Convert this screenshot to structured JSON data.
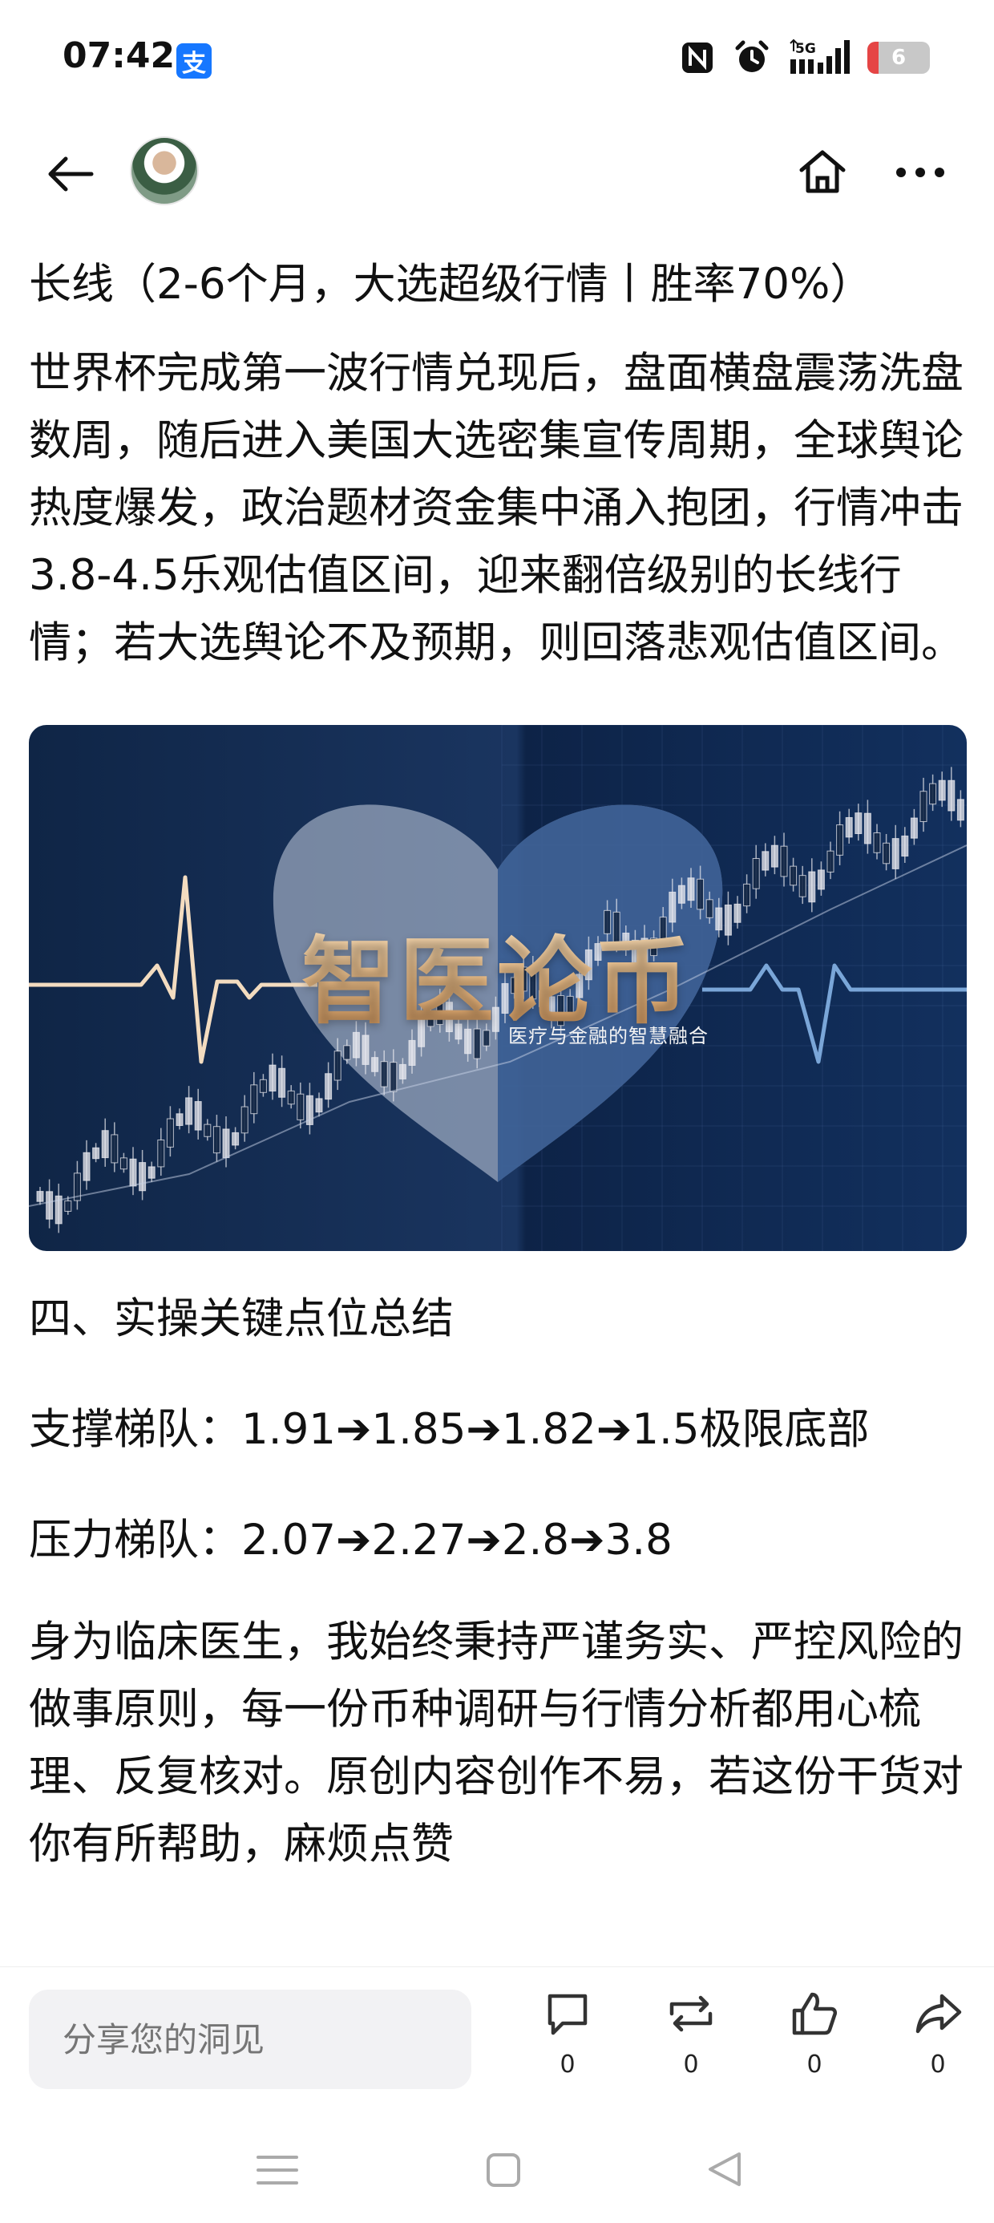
{
  "status_bar": {
    "time": "07:42",
    "alipay_glyph": "支",
    "network": "5G",
    "battery_level": "6",
    "battery_fraction": 0.06,
    "icons": [
      "alipay-icon",
      "nfc-icon",
      "alarm-icon",
      "signal-5g-icon",
      "battery-icon"
    ]
  },
  "header": {
    "icons": [
      "back-arrow-icon",
      "avatar",
      "home-icon",
      "more-icon"
    ]
  },
  "article": {
    "headline": "长线（2-6个月，大选超级行情丨胜率70%）",
    "paragraph1": "世界杯完成第一波行情兑现后，盘面横盘震荡洗盘数周，随后进入美国大选密集宣传周期，全球舆论热度爆发，政治题材资金集中涌入抱团，行情冲击3.8-4.5乐观估值区间，迎来翻倍级别的长线行情；若大选舆论不及预期，则回落悲观估值区间。",
    "banner": {
      "title": "智医论币",
      "subtitle": "医疗与金融的智慧融合"
    },
    "section_title": "四、实操关键点位总结",
    "support_ladder": "支撑梯队：1.91➔1.85➔1.82➔1.5极限底部",
    "pressure_ladder": "压力梯队：2.07➔2.27➔2.8➔3.8",
    "paragraph2": " 身为临床医生，我始终秉持严谨务实、严控风险的做事原则，每一份币种调研与行情分析都用心梳理、反复核对。原创内容创作不易，若这份干货对你有所帮助，麻烦点赞"
  },
  "bottom_bar": {
    "input_placeholder": "分享您的洞见",
    "comment_count": "0",
    "repost_count": "0",
    "like_count": "0",
    "share_count": "0"
  },
  "colors": {
    "banner_dark": "#0f2546",
    "gold": "#e8b881",
    "battery_red": "#e54545"
  }
}
